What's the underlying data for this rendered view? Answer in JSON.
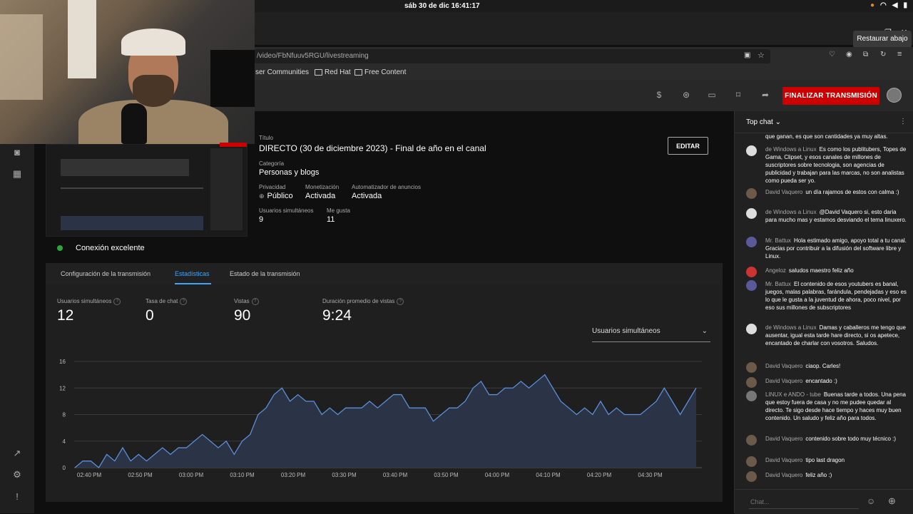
{
  "system": {
    "clock": "sáb 30 de dic  16:41:17"
  },
  "browser": {
    "url": "/video/FbNfuuv5RGU/livestreaming",
    "bookmarks": [
      "ser Communities",
      "Red Hat",
      "Free Content"
    ],
    "tooltip": "Restaurar abajo"
  },
  "header": {
    "end_button": "FINALIZAR TRANSMISIÓN"
  },
  "stream": {
    "connection": "Conexión excelente",
    "title_label": "Título",
    "title": "DIRECTO (30 de diciembre 2023) - Final de año en el canal",
    "category_label": "Categoría",
    "category": "Personas y blogs",
    "privacy_label": "Privacidad",
    "privacy": "Público",
    "monetization_label": "Monetización",
    "monetization": "Activada",
    "ads_label": "Automatizador de anuncios",
    "ads": "Activada",
    "viewers_label": "Usuarios simultáneos",
    "viewers": "9",
    "likes_label": "Me gusta",
    "likes": "11",
    "edit_button": "EDITAR"
  },
  "tabs": [
    "Configuración de la transmisión",
    "Estadísticas",
    "Estado de la transmisión"
  ],
  "stats": [
    {
      "label": "Usuarios simultáneos",
      "value": "12"
    },
    {
      "label": "Tasa de chat",
      "value": "0"
    },
    {
      "label": "Vistas",
      "value": "90"
    },
    {
      "label": "Duración promedio de vistas",
      "value": "9:24"
    }
  ],
  "metric_select": "Usuarios simultáneos",
  "chart_data": {
    "type": "area",
    "x": [
      "02:40 PM",
      "02:50 PM",
      "03:00 PM",
      "03:10 PM",
      "03:20 PM",
      "03:30 PM",
      "03:40 PM",
      "03:50 PM",
      "04:00 PM",
      "04:10 PM",
      "04:20 PM",
      "04:30 PM"
    ],
    "y_ticks": [
      0,
      4,
      8,
      12,
      16
    ],
    "ylim": [
      0,
      16
    ],
    "values": [
      0,
      1,
      1,
      0,
      2,
      1,
      3,
      1,
      2,
      1,
      2,
      3,
      2,
      3,
      3,
      4,
      5,
      4,
      3,
      4,
      2,
      4,
      5,
      8,
      9,
      11,
      12,
      10,
      11,
      10,
      10,
      8,
      9,
      8,
      9,
      9,
      9,
      10,
      9,
      10,
      11,
      11,
      9,
      9,
      9,
      7,
      8,
      9,
      9,
      10,
      12,
      13,
      11,
      11,
      12,
      12,
      13,
      12,
      13,
      14,
      12,
      10,
      9,
      8,
      9,
      8,
      10,
      8,
      9,
      8,
      8,
      8,
      9,
      10,
      12,
      10,
      8,
      10,
      12
    ],
    "xlabel": "",
    "ylabel": "",
    "grid": true
  },
  "chat": {
    "title": "Top chat",
    "input_placeholder": "Chat...",
    "messages": [
      {
        "author": "",
        "text": "que ganan, es que son cantidades ya muy altas."
      },
      {
        "author": "de Windows a Linux",
        "text": "Es como los publitubers, Topes de Gama, Clipset, y esos canales de millones de suscriptores sobre tecnologia, son agencias de publicidad y trabajan para las marcas, no son analistas como pueda ser yo."
      },
      {
        "author": "David Vaquero",
        "text": "un día rajamos de estos con calma :)"
      },
      {
        "author": "de Windows a Linux",
        "text": "@David Vaquero si, esto daria para mucho mas y estamos desviando el tema linuxero."
      },
      {
        "author": "Mr. Battux",
        "text": "Hola estimado amigo, apoyo total a tu canal. Gracias por contribuir a la difusión del software libre y Linux."
      },
      {
        "author": "Angeloz",
        "text": "saludos maestro feliz año"
      },
      {
        "author": "Mr. Battux",
        "text": "El contenido de esos youtubers es banal, juegos, malas palabras, farándula, pendejadas y eso es lo que le gusta a la juventud de ahora, poco nivel, por eso sus millones de subscriptores"
      },
      {
        "author": "de Windows a Linux",
        "text": "Damas y caballeros me tengo que ausentar, igual esta tarde hare directo, si os apetece, encantado de charlar con vosotros. Saludos."
      },
      {
        "author": "David Vaquero",
        "text": "ciaop. Carles!"
      },
      {
        "author": "David Vaquero",
        "text": "encantado :)"
      },
      {
        "author": "LINUX e ANDO - tube",
        "text": "Buenas tarde a todos. Una pena que estoy fuera de casa y no me pudee quedar al directo. Te sigo desde hace tiempo y haces muy buen contenido. Un saludo y feliz año para todos."
      },
      {
        "author": "David Vaquero",
        "text": "contenido sobre todo muy técnico :)"
      },
      {
        "author": "David Vaquero",
        "text": "tipo last dragon"
      },
      {
        "author": "David Vaquero",
        "text": "feliz año :)"
      }
    ]
  },
  "colors": {
    "accent": "#3ea6ff",
    "end_button": "#cc0000",
    "connection_ok": "#2ba640",
    "chart_line": "#5b8fd9",
    "chart_fill": "#2a3446"
  }
}
